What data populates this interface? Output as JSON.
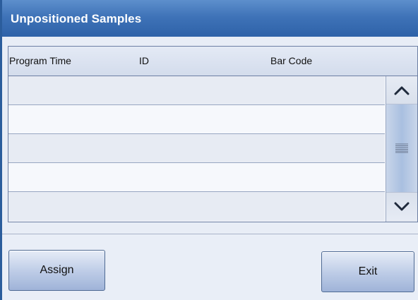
{
  "dialog": {
    "title": "Unpositioned Samples"
  },
  "table": {
    "columns": [
      {
        "label": "Program Time"
      },
      {
        "label": "ID"
      },
      {
        "label": "Bar Code"
      }
    ],
    "rows": [
      {
        "program_time": "",
        "id": "",
        "bar_code": ""
      },
      {
        "program_time": "",
        "id": "",
        "bar_code": ""
      },
      {
        "program_time": "",
        "id": "",
        "bar_code": ""
      },
      {
        "program_time": "",
        "id": "",
        "bar_code": ""
      },
      {
        "program_time": "",
        "id": "",
        "bar_code": ""
      }
    ]
  },
  "scrollbar": {
    "up_icon": "chevron-up-icon",
    "down_icon": "chevron-down-icon",
    "thumb_icon": "grip-lines-icon"
  },
  "footer": {
    "assign_label": "Assign",
    "exit_label": "Exit"
  },
  "colors": {
    "title_bar": "#3f73b8",
    "title_text": "#ffffff",
    "background": "#e9eef7",
    "button_gradient_bottom": "#9fb3d8"
  }
}
